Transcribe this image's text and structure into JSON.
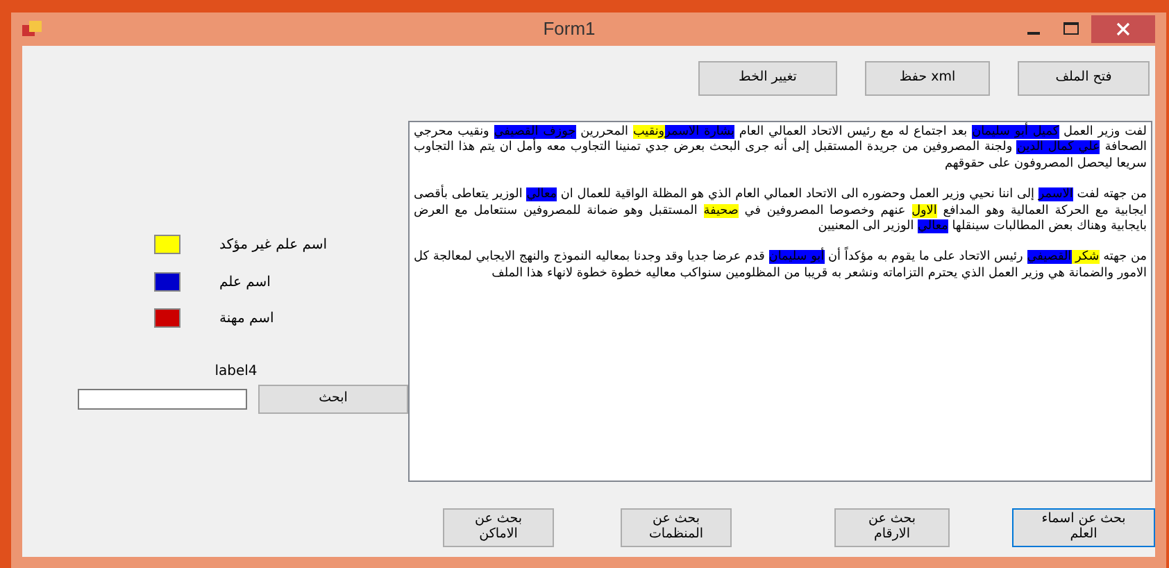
{
  "window": {
    "title": "Form1"
  },
  "top_buttons": [
    "فتح الملف",
    "حفظ xml",
    "تغيير الخط"
  ],
  "legend": [
    {
      "label": "اسم علم غير مؤكد",
      "color": "#ffff00"
    },
    {
      "label": "اسم علم",
      "color": "#0000cc"
    },
    {
      "label": "اسم مهنة",
      "color": "#cc0000"
    }
  ],
  "search": {
    "label": "label4",
    "button": "ابحث"
  },
  "document": {
    "paragraphs": [
      [
        {
          "text": "لفت وزير العمل "
        },
        {
          "text": "كميل أبو سليمان",
          "color": "#0000ff"
        },
        {
          "text": " بعد اجتماع له مع رئيس الاتحاد العمالي العام "
        },
        {
          "text": "بشارة الاسمر",
          "color": "#0000ff"
        },
        {
          "text": "ونقيب",
          "color": "#ffff00"
        },
        {
          "text": " المحررين "
        },
        {
          "text": "جوزف القصيفي",
          "color": "#0000ff"
        },
        {
          "text": " ونقيب محرجي الصحافة "
        },
        {
          "text": "علي كمال الدين",
          "color": "#0000ff"
        },
        {
          "text": " ولجنة المصروفين من جريدة المستقبل إلى أنه جرى البحث بعرض جدي تمنينا التجاوب معه وأمل ان يتم هذا التجاوب سريعا ليحصل المصروفون على حقوقهم"
        }
      ],
      [
        {
          "text": "من جهته لفت "
        },
        {
          "text": "الاسمر",
          "color": "#0000ff"
        },
        {
          "text": " إلى اننا نحيي وزير العمل وحضوره الى الاتحاد العمالي العام الذي هو المظلة الواقية للعمال ان "
        },
        {
          "text": "معالي",
          "color": "#0000ff"
        },
        {
          "text": " الوزير يتعاطى بأقصى ايجابية مع الحركة العمالية وهو المدافع "
        },
        {
          "text": "الاول",
          "color": "#ffff00"
        },
        {
          "text": " عنهم وخصوصا المصروفين في "
        },
        {
          "text": "صحيفة",
          "color": "#ffff00"
        },
        {
          "text": " المستقبل وهو ضمانة للمصروفين سنتعامل مع العرض بايجابية وهناك بعض المطالبات سينقلها "
        },
        {
          "text": "معالي",
          "color": "#0000ff"
        },
        {
          "text": " الوزير الى المعنيين"
        }
      ],
      [
        {
          "text": "من جهته "
        },
        {
          "text": "شكر ",
          "color": "#ffff00"
        },
        {
          "text": "القصيفي",
          "color": "#0000ff"
        },
        {
          "text": " رئيس الاتحاد على ما يقوم به مؤكداً أن "
        },
        {
          "text": "أبو سليمان",
          "color": "#0000ff"
        },
        {
          "text": " قدم عرضا جديا وقد وجدنا بمعاليه النموذج والنهج الايجابي لمعالجة كل الامور والضمانة هي وزير العمل الذي يحترم التزاماته ونشعر به قريبا من المظلومين سنواكب معاليه خطوة خطوة لانهاء هذا الملف"
        }
      ]
    ]
  },
  "bottom_buttons": [
    {
      "label": "بحث عن اسماء العلم",
      "selected": true
    },
    {
      "label": "بحث عن الارقام",
      "selected": false
    },
    {
      "label": "بحث عن المنظمات",
      "selected": false
    },
    {
      "label": "بحث عن الاماكن",
      "selected": false
    }
  ]
}
